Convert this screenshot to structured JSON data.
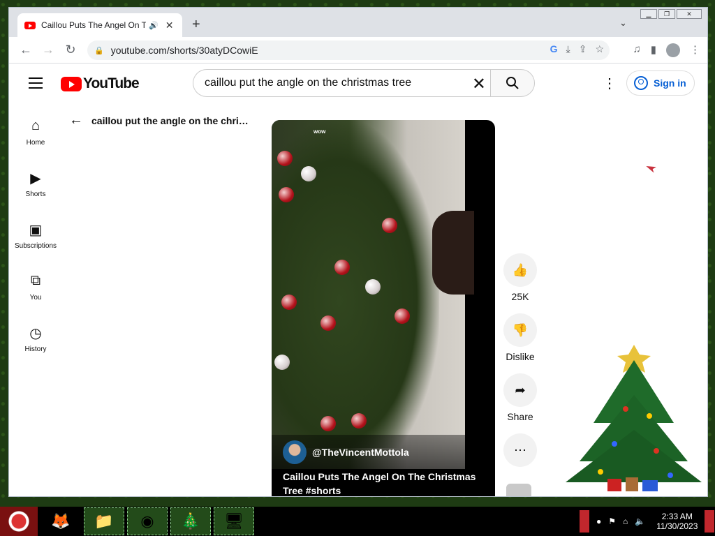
{
  "browser": {
    "tab_title": "Caillou Puts The Angel On T",
    "tab_audio_icon": "speaker-icon",
    "url": "youtube.com/shorts/30atyDCowiE",
    "new_tab_symbol": "+",
    "close_symbol": "✕"
  },
  "youtube": {
    "logo_text": "YouTube",
    "search_query": "caillou put the angle on the christmas tree",
    "sign_in_label": "Sign in",
    "sidebar": [
      {
        "label": "Home",
        "icon": "home-icon"
      },
      {
        "label": "Shorts",
        "icon": "shorts-icon"
      },
      {
        "label": "Subscriptions",
        "icon": "subscriptions-icon"
      },
      {
        "label": "You",
        "icon": "you-icon"
      },
      {
        "label": "History",
        "icon": "history-icon"
      }
    ],
    "back_query": "caillou put the angle on the christmas tree",
    "video": {
      "overlay_text": "wow",
      "channel": "@TheVincentMottola",
      "title": "Caillou Puts The Angel On The Christmas Tree #shorts"
    },
    "actions": {
      "like_count": "25K",
      "dislike_label": "Dislike",
      "share_label": "Share"
    }
  },
  "taskbar": {
    "time": "2:33 AM",
    "date": "11/30/2023"
  },
  "colors": {
    "youtube_red": "#ff0000",
    "link_blue": "#065fd4"
  }
}
